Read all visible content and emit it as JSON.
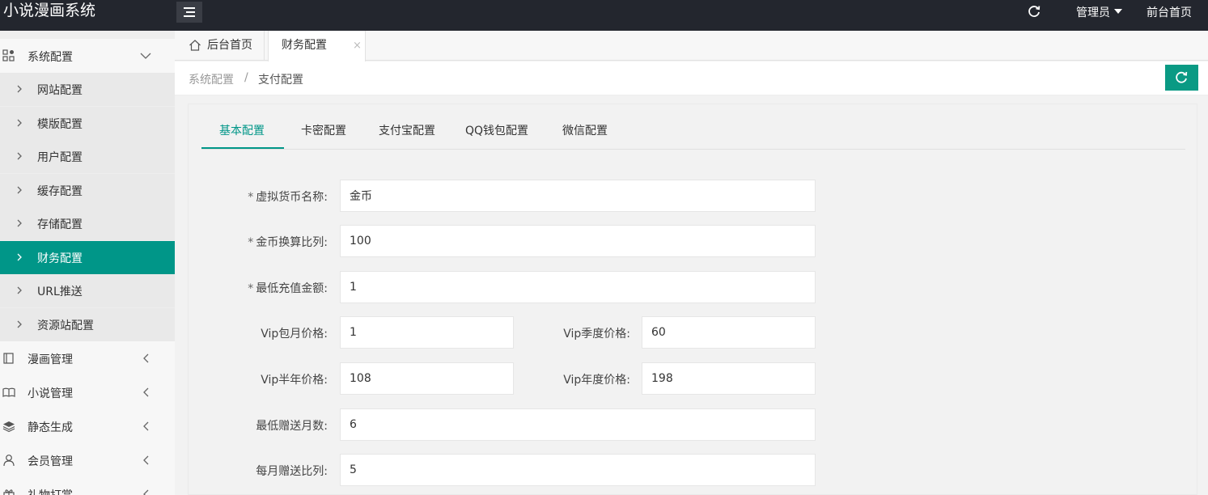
{
  "app": {
    "title": "小说漫画系统"
  },
  "topbar": {
    "admin_label": "管理员",
    "front_label": "前台首页"
  },
  "sidebar": {
    "groups": [
      {
        "label": "系统配置",
        "expanded": true
      },
      {
        "label": "漫画管理"
      },
      {
        "label": "小说管理"
      },
      {
        "label": "静态生成"
      },
      {
        "label": "会员管理"
      },
      {
        "label": "礼物打赏"
      }
    ],
    "sub_items": [
      {
        "label": "网站配置"
      },
      {
        "label": "模版配置"
      },
      {
        "label": "用户配置"
      },
      {
        "label": "缓存配置"
      },
      {
        "label": "存储配置"
      },
      {
        "label": "财务配置",
        "active": true
      },
      {
        "label": "URL推送"
      },
      {
        "label": "资源站配置"
      }
    ]
  },
  "tabs": [
    {
      "label": "后台首页"
    },
    {
      "label": "财务配置",
      "active": true,
      "close": "×"
    }
  ],
  "breadcrumb": {
    "parent": "系统配置",
    "separator": "/",
    "current": "支付配置"
  },
  "config_tabs": [
    "基本配置",
    "卡密配置",
    "支付宝配置",
    "QQ钱包配置",
    "微信配置"
  ],
  "form": {
    "required_mark": "*",
    "currency_name": {
      "label": "虚拟货币名称:",
      "value": "金币"
    },
    "exchange_ratio": {
      "label": "金币换算比列:",
      "value": "100"
    },
    "min_recharge": {
      "label": "最低充值金额:",
      "value": "1"
    },
    "vip_month": {
      "label": "Vip包月价格:",
      "value": "1"
    },
    "vip_quarter": {
      "label": "Vip季度价格:",
      "value": "60"
    },
    "vip_halfyear": {
      "label": "Vip半年价格:",
      "value": "108"
    },
    "vip_year": {
      "label": "Vip年度价格:",
      "value": "198"
    },
    "min_gift_months": {
      "label": "最低赠送月数:",
      "value": "6"
    },
    "monthly_gift_ratio": {
      "label": "每月赠送比列:",
      "value": "5"
    }
  },
  "colors": {
    "accent": "#009688",
    "topbar": "#23262e"
  }
}
